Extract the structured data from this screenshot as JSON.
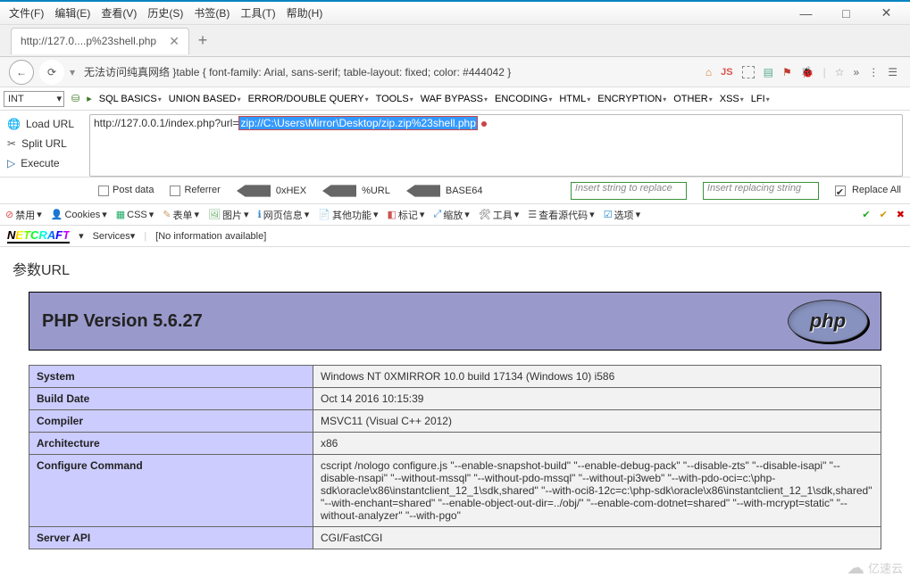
{
  "menubar": [
    "文件(F)",
    "编辑(E)",
    "查看(V)",
    "历史(S)",
    "书签(B)",
    "工具(T)",
    "帮助(H)"
  ],
  "window": {
    "min": "—",
    "max": "□",
    "close": "✕"
  },
  "tab": {
    "title": "http://127.0....p%23shell.php",
    "add": "+"
  },
  "nav": {
    "address_prefix": "无法访问纯真网络  }table { font-family: Arial, sans-serif; table-layout: fixed; color: #444042 }",
    "extra_icons": [
      "home",
      "JS",
      "gear1",
      "gear2",
      "flag",
      "bug",
      "star",
      "more",
      "dots",
      "hamburger"
    ]
  },
  "sqlbar": {
    "left": "INT",
    "items": [
      "SQL BASICS",
      "UNION BASED",
      "ERROR/DOUBLE QUERY",
      "TOOLS",
      "WAF BYPASS",
      "ENCODING",
      "HTML",
      "ENCRYPTION",
      "OTHER",
      "XSS",
      "LFI"
    ]
  },
  "urlpanel": {
    "side": [
      "Load URL",
      "Split URL",
      "Execute"
    ],
    "prefix": "http://127.0.0.1/index.php?url=",
    "selected": "zip://C:\\Users\\Mirror\\Desktop/zip.zip%23shell.php"
  },
  "optrow": {
    "post": "Post data",
    "ref": "Referrer",
    "hex": "0xHEX",
    "url": "%URL",
    "b64": "BASE64",
    "ins1": "Insert string to replace",
    "ins2": "Insert replacing string",
    "replaceall": "Replace All"
  },
  "devbar": [
    "禁用",
    "Cookies",
    "CSS",
    "表单",
    "图片",
    "网页信息",
    "其他功能",
    "标记",
    "缩放",
    "工具",
    "查看源代码",
    "选项"
  ],
  "netcraft": {
    "services": "Services",
    "info": "[No information available]"
  },
  "page": {
    "heading": "参数URL",
    "phpver": "PHP Version 5.6.27",
    "table": [
      [
        "System",
        "Windows NT 0XMIRROR 10.0 build 17134 (Windows 10) i586"
      ],
      [
        "Build Date",
        "Oct 14 2016 10:15:39"
      ],
      [
        "Compiler",
        "MSVC11 (Visual C++ 2012)"
      ],
      [
        "Architecture",
        "x86"
      ],
      [
        "Configure Command",
        "cscript /nologo configure.js \"--enable-snapshot-build\" \"--enable-debug-pack\" \"--disable-zts\" \"--disable-isapi\" \"--disable-nsapi\" \"--without-mssql\" \"--without-pdo-mssql\" \"--without-pi3web\" \"--with-pdo-oci=c:\\php-sdk\\oracle\\x86\\instantclient_12_1\\sdk,shared\" \"--with-oci8-12c=c:\\php-sdk\\oracle\\x86\\instantclient_12_1\\sdk,shared\" \"--with-enchant=shared\" \"--enable-object-out-dir=../obj/\" \"--enable-com-dotnet=shared\" \"--with-mcrypt=static\" \"--without-analyzer\" \"--with-pgo\""
      ],
      [
        "Server API",
        "CGI/FastCGI"
      ]
    ]
  },
  "watermark": "亿速云"
}
